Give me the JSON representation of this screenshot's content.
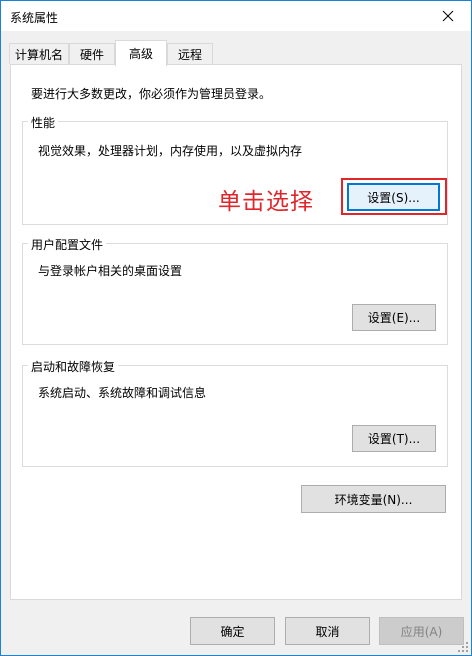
{
  "window": {
    "title": "系统属性"
  },
  "tabs": [
    {
      "label": "计算机名"
    },
    {
      "label": "硬件"
    },
    {
      "label": "高级",
      "active": true
    },
    {
      "label": "远程"
    }
  ],
  "notice": "要进行大多数更改，你必须作为管理员登录。",
  "performance": {
    "title": "性能",
    "desc": "视觉效果，处理器计划，内存使用，以及虚拟内存",
    "button": "设置(S)..."
  },
  "annotation": "单击选择",
  "profiles": {
    "title": "用户配置文件",
    "desc": "与登录帐户相关的桌面设置",
    "button": "设置(E)..."
  },
  "startup": {
    "title": "启动和故障恢复",
    "desc": "系统启动、系统故障和调试信息",
    "button": "设置(T)..."
  },
  "env_button": "环境变量(N)...",
  "footer": {
    "ok": "确定",
    "cancel": "取消",
    "apply": "应用(A)"
  },
  "colors": {
    "window_border": "#1883d7",
    "annotation_red": "#e0262b",
    "focus_blue": "#0078d7"
  },
  "icons": {
    "close": "close-icon",
    "grip": "resize-grip-icon"
  }
}
